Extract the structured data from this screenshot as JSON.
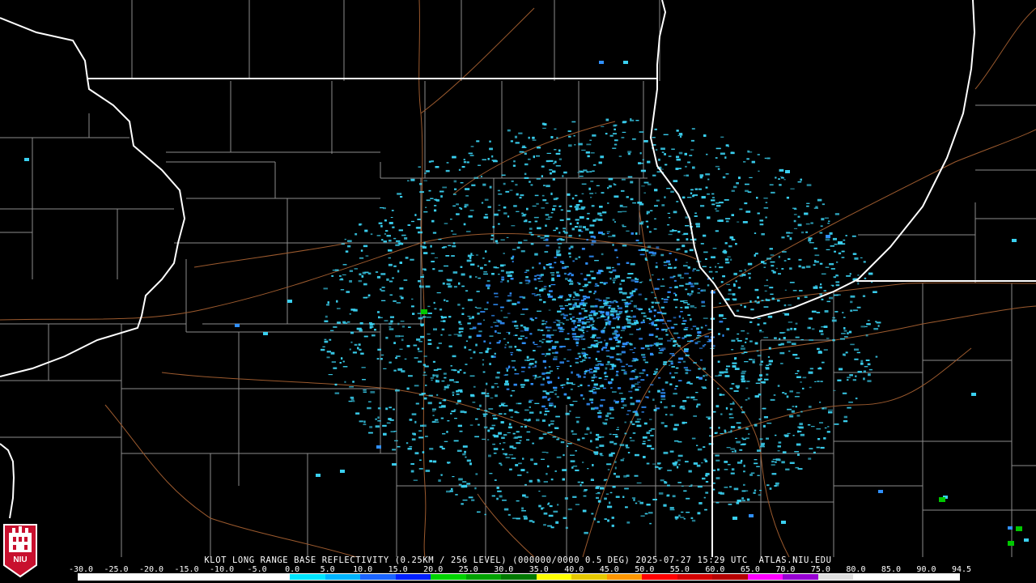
{
  "product": {
    "caption": "KLOT LONG RANGE BASE REFLECTIVITY (0.25KM / 256 LEVEL) (000000/0000 0.5 DEG) 2025-07-27 15:29 UTC  ATLAS.NIU.EDU",
    "station": "KLOT",
    "timestamp": "2025-07-27 15:29 UTC",
    "elevation": "0.5 DEG"
  },
  "logo": {
    "text": "NIU"
  },
  "colorscale": {
    "labels": [
      "-30.0",
      "-25.0",
      "-20.0",
      "-15.0",
      "-10.0",
      "-5.0",
      "0.0",
      "5.0",
      "10.0",
      "15.0",
      "20.0",
      "25.0",
      "30.0",
      "35.0",
      "40.0",
      "45.0",
      "50.0",
      "55.0",
      "60.0",
      "65.0",
      "70.0",
      "75.0",
      "80.0",
      "85.0",
      "90.0",
      "94.5"
    ],
    "colors": [
      "#ffffff",
      "#ffffff",
      "#ffffff",
      "#ffffff",
      "#ffffff",
      "#ffffff",
      "#00e5ff",
      "#00b4ff",
      "#1a64ff",
      "#0020ff",
      "#00d200",
      "#00a000",
      "#007800",
      "#ffff00",
      "#e6c800",
      "#ff9600",
      "#ff0000",
      "#d20000",
      "#b40000",
      "#ff00ff",
      "#9600d2",
      "#e0e0e0",
      "#ffffff",
      "#ffffff",
      "#ffffff"
    ]
  },
  "colors": {
    "state_border": "#ffffff",
    "county_border": "#8c8c8c",
    "road": "#9c5a2e",
    "echo_light": "#3ad0f0",
    "echo_mid": "#3090ff",
    "echo_strong": "#00c800"
  }
}
